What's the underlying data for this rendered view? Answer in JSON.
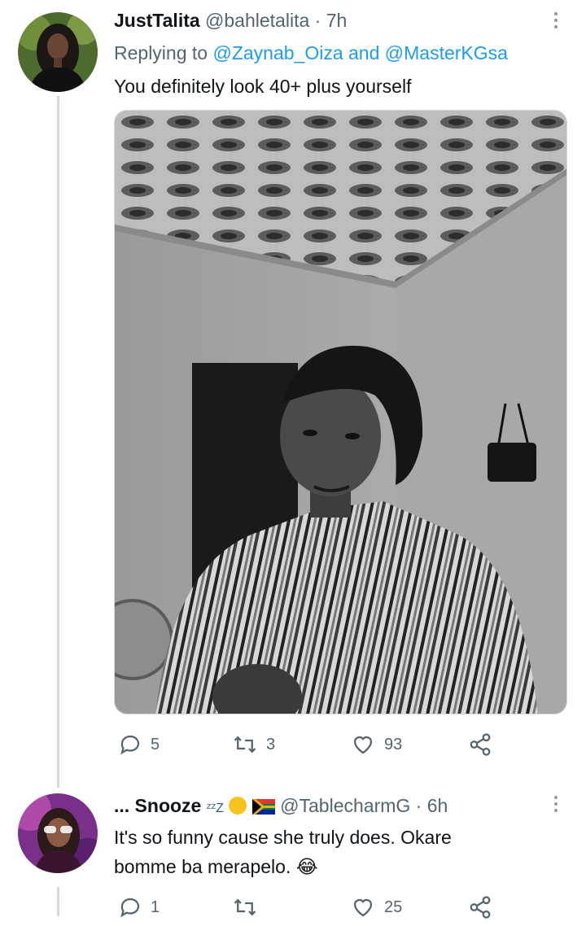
{
  "tweets": [
    {
      "display_name": "JustTalita",
      "handle": "@bahletalita",
      "time": "· 7h",
      "replying_prefix": "Replying to",
      "replying_user1": "@Zaynab_Oiza",
      "replying_and": "and",
      "replying_user2": "@MasterKGsa",
      "text": "You definitely look 40+ plus yourself",
      "counts": {
        "replies": "5",
        "retweets": "3",
        "likes": "93"
      }
    },
    {
      "display_name": "... Snooze",
      "name_emoji": "ᶻᶻZ",
      "handle": "@TablecharmG",
      "time": "· 6h",
      "text_line1": "It's so funny cause she truly does. Okare",
      "text_line2": "bomme ba merapelo.",
      "text_emoji": "😂",
      "counts": {
        "replies": "1",
        "retweets": "",
        "likes": "25"
      }
    }
  ],
  "colors": {
    "link": "#1d9bf0",
    "muted": "#536471",
    "thread_line": "#cfd9de"
  },
  "icons": [
    "more-icon",
    "reply-icon",
    "retweet-icon",
    "like-icon",
    "share-icon"
  ]
}
